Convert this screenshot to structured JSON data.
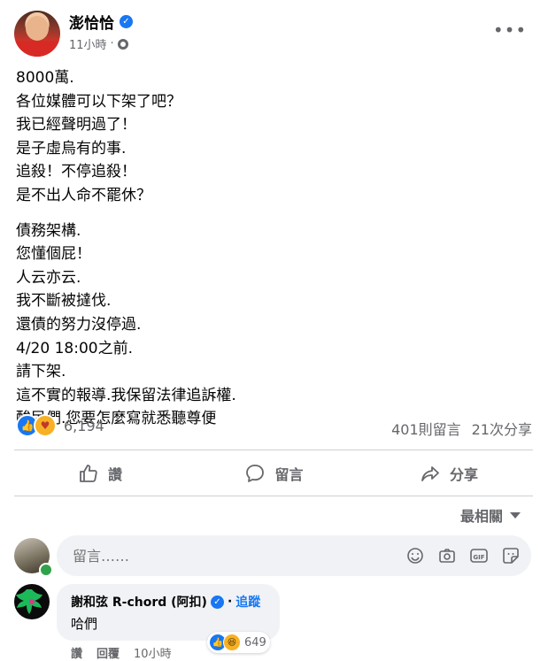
{
  "post": {
    "author": "澎恰恰",
    "timestamp": "11小時",
    "visibility_icon": "globe-icon",
    "paragraphs": [
      [
        "8000萬.",
        "各位媒體可以下架了吧？",
        "我已經聲明過了！",
        "是子虛烏有的事.",
        "追殺！不停追殺！",
        "是不出人命不罷休？"
      ],
      [
        "債務架構.",
        "您懂個屁！",
        "人云亦云.",
        "我不斷被撻伐.",
        "還債的努力沒停過.",
        "4/20 18:00之前.",
        "請下架.",
        "這不實的報導.我保留法律追訴權.",
        "酸民們.您要怎麼寫就悉聽尊便"
      ]
    ],
    "reaction_count": "6,194",
    "comments_count": "401則留言",
    "shares_count": "21次分享"
  },
  "actions": {
    "like": "讚",
    "comment": "留言",
    "share": "分享"
  },
  "sort_label": "最相關",
  "composer": {
    "placeholder": "留言……"
  },
  "comment": {
    "author": "謝和弦 R-chord (阿扣)",
    "follow": "追蹤",
    "text": "哈們",
    "reaction_count": "649",
    "like_label": "讚",
    "reply_label": "回覆",
    "time": "10小時"
  },
  "colors": {
    "accent": "#1877f2",
    "secondary_text": "#65676b",
    "bubble": "#f0f2f5"
  }
}
